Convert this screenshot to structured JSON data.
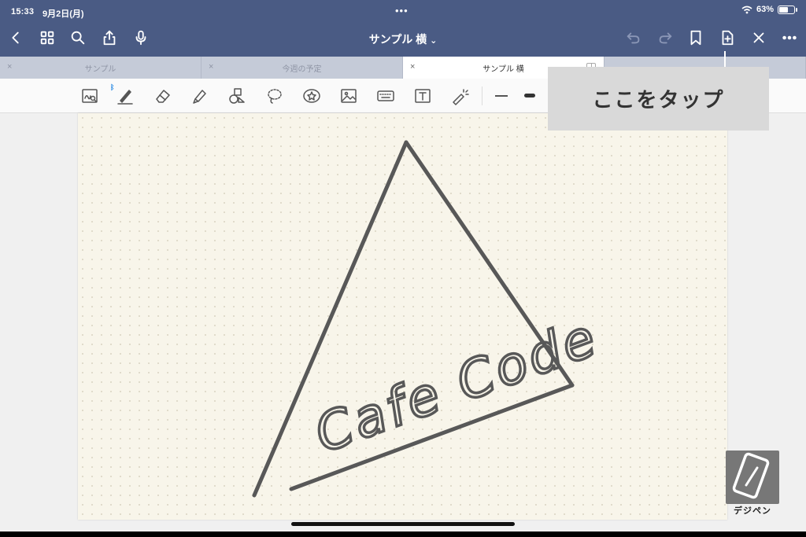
{
  "status": {
    "time": "15:33",
    "date": "9月2日(月)",
    "battery": "63%",
    "battery_level": 0.63
  },
  "nav": {
    "title": "サンプル 横",
    "title_chevron": "⌄"
  },
  "tabs": [
    {
      "label": "サンプル",
      "close": "×"
    },
    {
      "label": "今週の予定",
      "close": "×"
    },
    {
      "label": "サンプル 横",
      "close": "×",
      "active": true
    },
    {
      "label": "…",
      "close": ""
    }
  ],
  "callout": {
    "text": "ここをタップ"
  },
  "drawing": {
    "handwriting": "Cafe Code"
  },
  "watermark": {
    "text": "デジペン"
  },
  "toolbar": {
    "bluetooth_mark": "ᛒ"
  },
  "colors": {
    "navbar": "#4a5b84",
    "tabbar": "#c5cbd8",
    "paper": "#f8f5ea",
    "ink": "#555555",
    "callout": "#d9d9d9"
  }
}
